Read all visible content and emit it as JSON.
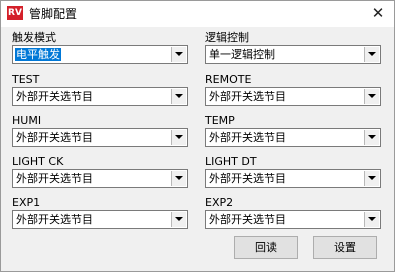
{
  "window": {
    "title": "管脚配置",
    "icon_text": "RV",
    "close_glyph": "✕"
  },
  "fields": {
    "trigger_mode": {
      "label": "触发模式",
      "value": "电平触发"
    },
    "logic_control": {
      "label": "逻辑控制",
      "value": "单一逻辑控制"
    },
    "test": {
      "label": "TEST",
      "value": "外部开关选节目"
    },
    "remote": {
      "label": "REMOTE",
      "value": "外部开关选节目"
    },
    "humi": {
      "label": "HUMI",
      "value": "外部开关选节目"
    },
    "temp": {
      "label": "TEMP",
      "value": "外部开关选节目"
    },
    "light_ck": {
      "label": "LIGHT CK",
      "value": "外部开关选节目"
    },
    "light_dt": {
      "label": "LIGHT DT",
      "value": "外部开关选节目"
    },
    "exp1": {
      "label": "EXP1",
      "value": "外部开关选节目"
    },
    "exp2": {
      "label": "EXP2",
      "value": "外部开关选节目"
    }
  },
  "buttons": {
    "readback": "回读",
    "settings": "设置"
  },
  "colors": {
    "selection": "#0078d7",
    "app_icon": "#d4202a"
  }
}
